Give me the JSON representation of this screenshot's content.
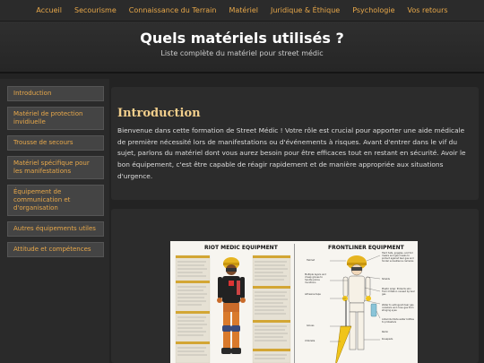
{
  "nav": {
    "items": [
      "Accueil",
      "Secourisme",
      "Connaissance du Terrain",
      "Matériel",
      "Juridique & Éthique",
      "Psychologie",
      "Vos retours"
    ]
  },
  "header": {
    "title": "Quels matériels utilisés ?",
    "subtitle": "Liste complète du matériel pour street médic"
  },
  "sidebar": {
    "items": [
      "Introduction",
      "Matériel de protection invidiuelle",
      "Trousse de secours",
      "Matériel spécifique pour les manifestations",
      "Équipement de communication et d'organisation",
      "Autres équipements utiles",
      "Attitude et compétences"
    ]
  },
  "intro": {
    "heading": "Introduction",
    "body": "Bienvenue dans cette formation de Street Médic ! Votre rôle est crucial pour apporter une aide médicale de première nécessité lors de manifestations ou d'événements à risques. Avant d'entrer dans le vif du sujet, parlons du matériel dont vous aurez besoin pour être efficaces tout en restant en sécurité. Avoir le bon équipement, c'est être capable de réagir rapidement et de manière appropriée aux situations d'urgence."
  },
  "poster": {
    "left_title": "RIOT MEDIC EQUIPMENT",
    "right_title": "FRONTLINER EQUIPMENT",
    "labels": {
      "helmet": "Helmet",
      "radio": "Radio",
      "gloves": "Gloves",
      "umbrella": "Umbrella",
      "kneepads": "Kneepads",
      "hardhats": "Hard hats, goggles, and full masks and gas masks to protect against tear gas and hinder surveillance cameras",
      "tshirt": "Multiple layers and cheap gloves to handle police munitions",
      "shields": "Shields",
      "plastic": "Plastic wrap: Protects skin from irritation caused by tear gas",
      "water": "Water to extinguish tear gas canisters and rinse gas from stinging eyes",
      "adhesive": "Adhesive tape",
      "antacids": "Antacids dilute water bottles to protesters"
    }
  }
}
